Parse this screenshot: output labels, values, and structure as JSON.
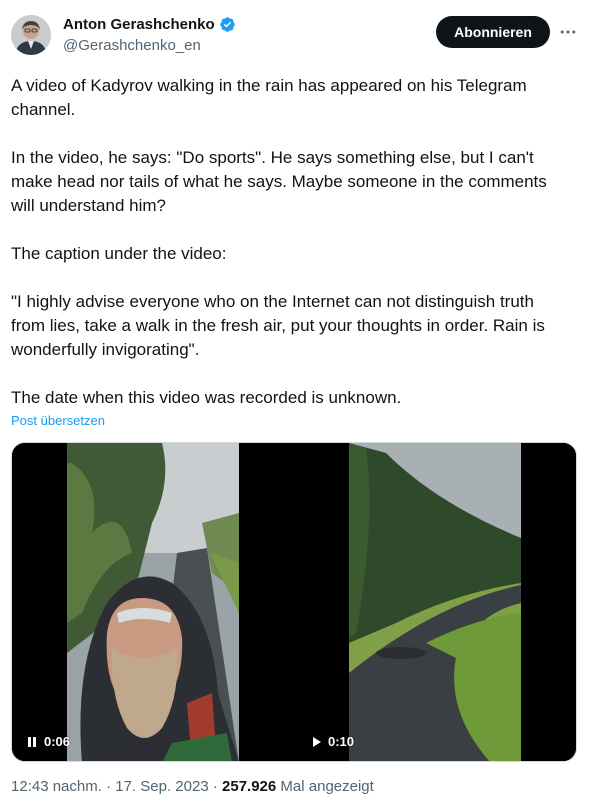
{
  "author": {
    "display_name": "Anton Gerashchenko",
    "handle": "@Gerashchenko_en",
    "verified": true,
    "avatar": "avatar-photo"
  },
  "actions": {
    "subscribe_label": "Abonnieren",
    "more_icon": "more-horizontal-icon"
  },
  "post": {
    "paragraphs": [
      "A video of Kadyrov walking in the rain has appeared on his Telegram channel.",
      "In the video, he says: \"Do sports\". He says something else, but I can't make head nor tails of what he says. Maybe someone in the comments will understand him?",
      "The caption under the video:",
      "\"I highly advise everyone who on the Internet can not distinguish truth from lies, take a walk in the fresh air, put your thoughts in order. Rain is wonderfully invigorating\".",
      "The date when this video was recorded is unknown."
    ],
    "translate_label": "Post übersetzen"
  },
  "media": [
    {
      "state_icon": "pause-icon",
      "duration": "0:06"
    },
    {
      "state_icon": "play-icon",
      "duration": "0:10"
    }
  ],
  "meta": {
    "time": "12:43 nachm.",
    "separator": "·",
    "date": "17. Sep. 2023",
    "views": "257.926",
    "views_label": "Mal angezeigt"
  },
  "colors": {
    "link": "#1d9bf0",
    "secondary_text": "#536471",
    "primary_text": "#0f1419",
    "button_bg": "#0f1419"
  }
}
